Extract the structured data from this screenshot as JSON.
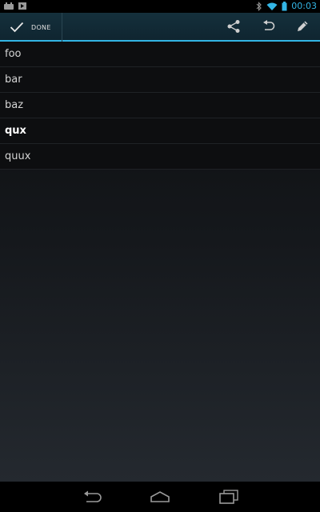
{
  "status_bar": {
    "time": "00:03",
    "left_icons": [
      "android-notification-icon",
      "media-notification-icon"
    ],
    "right_icons": [
      "bluetooth-icon",
      "wifi-icon",
      "battery-icon"
    ]
  },
  "action_bar": {
    "done_label": "DONE",
    "actions": [
      "share-icon",
      "undo-icon",
      "edit-icon"
    ],
    "accent_color": "#33b5e5"
  },
  "list": {
    "items": [
      {
        "label": "foo"
      },
      {
        "label": "bar"
      },
      {
        "label": "baz"
      },
      {
        "label": "qux"
      },
      {
        "label": "quux"
      }
    ]
  },
  "nav_bar": {
    "buttons": [
      "back-icon",
      "home-icon",
      "recent-apps-icon"
    ]
  }
}
